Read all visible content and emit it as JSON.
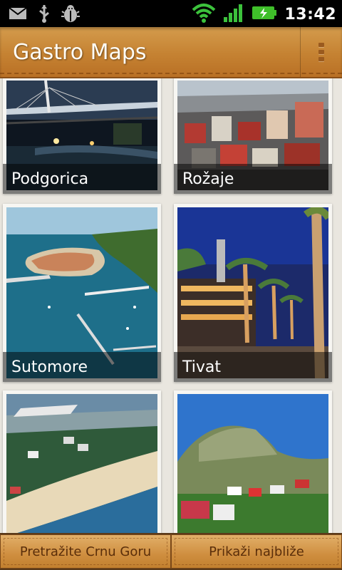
{
  "status_bar": {
    "time": "13:42",
    "left_icons": [
      "mail-icon",
      "usb-icon",
      "debug-bug-icon"
    ],
    "right_icons": [
      "wifi-icon",
      "signal-icon",
      "battery-charging-icon"
    ]
  },
  "app_bar": {
    "title": "Gastro Maps",
    "menu_icon": "overflow-menu-icon"
  },
  "cities": [
    {
      "label": "Podgorica"
    },
    {
      "label": "Rožaje"
    },
    {
      "label": "Sutomore"
    },
    {
      "label": "Tivat"
    },
    {
      "label": ""
    },
    {
      "label": ""
    }
  ],
  "bottom_bar": {
    "search_label": "Pretražite Crnu Goru",
    "nearest_label": "Prikaži najbliže"
  },
  "colors": {
    "app_bar": "#c58232",
    "label_overlay": "rgba(0,0,0,0.5)",
    "status_bar": "#000000",
    "battery": "#3fbf2a"
  }
}
